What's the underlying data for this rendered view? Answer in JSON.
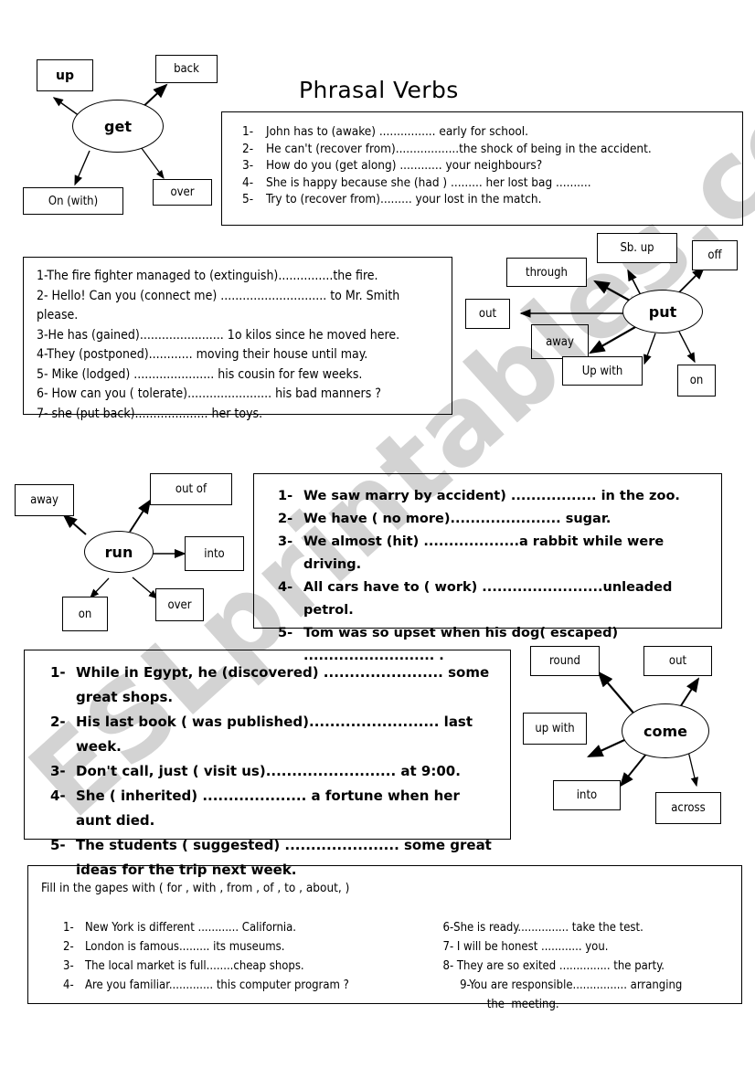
{
  "page": {
    "title": "Phrasal Verbs",
    "watermark": "ESLprintables.com"
  },
  "diagrams": [
    {
      "id": "get",
      "hub": "get",
      "nodes": [
        "up",
        "back",
        "On (with)",
        "over"
      ]
    },
    {
      "id": "put",
      "hub": "put",
      "nodes": [
        "Sb. up",
        "off",
        "through",
        "out",
        "away",
        "Up with",
        "on"
      ]
    },
    {
      "id": "run",
      "hub": "run",
      "nodes": [
        "away",
        "out of",
        "into",
        "on",
        "over"
      ]
    },
    {
      "id": "come",
      "hub": "come",
      "nodes": [
        "round",
        "out",
        "up with",
        "into",
        "across"
      ]
    }
  ],
  "exercise1": {
    "items": [
      {
        "num": "1-",
        "text": "John has to (awake) ................ early for school."
      },
      {
        "num": "2-",
        "text": "He can't (recover from)..................the shock of being in the accident."
      },
      {
        "num": "3-",
        "text": "How do you (get along) ............ your neighbours?"
      },
      {
        "num": "4-",
        "text": "She is happy because she (had )   ......... her lost bag .........."
      },
      {
        "num": "5-",
        "text": "Try to (recover from)......... your lost in the match."
      }
    ]
  },
  "exercise2": {
    "items": [
      {
        "num": "",
        "text": "1-The fire fighter managed to (extinguish)...............the fire."
      },
      {
        "num": "",
        "text": "2- Hello! Can you (connect me) ............................. to Mr. Smith"
      },
      {
        "num": "",
        "text": "please."
      },
      {
        "num": "",
        "text": "3-He has (gained)....................... 1o kilos since he moved here."
      },
      {
        "num": "",
        "text": "4-They (postponed)............ moving their house until may."
      },
      {
        "num": "",
        "text": "5- Mike (lodged) ...................... his cousin for few weeks."
      },
      {
        "num": "",
        "text": "6- How can you ( tolerate)....................... his bad manners  ?"
      },
      {
        "num": "",
        "text": "7- she (put back).................... her toys."
      }
    ]
  },
  "exercise3": {
    "items": [
      {
        "num": "1-",
        "text": "We  saw marry by accident) ................. in the zoo."
      },
      {
        "num": "2-",
        "text": "We have ( no more)...................... sugar."
      },
      {
        "num": "3-",
        "text": "We almost (hit) ...................a rabbit while were driving."
      },
      {
        "num": "4-",
        "text": "All cars have to ( work) ........................unleaded petrol."
      },
      {
        "num": "5-",
        "text": "Tom was so upset when his dog( escaped) .......................... ."
      }
    ]
  },
  "exercise4": {
    "items": [
      {
        "num": "1-",
        "text": "While in Egypt, he (discovered) ....................... some great shops."
      },
      {
        "num": "2-",
        "text": "His last book ( was published)......................... last week."
      },
      {
        "num": "3-",
        "text": "Don't call, just ( visit us)......................... at 9:00."
      },
      {
        "num": "4-",
        "text": "She  ( inherited) .................... a fortune when her aunt died."
      },
      {
        "num": "5-",
        "text": "The students ( suggested) ...................... some great ideas for the trip next week."
      }
    ]
  },
  "exercise5": {
    "heading": "Fill in the gapes with ( for , with ,  from , of , to , about,  )",
    "left_items": [
      {
        "num": "1-",
        "text": "New York is different ............ California."
      },
      {
        "num": "2-",
        "text": "London is famous......... its museums."
      },
      {
        "num": "3-",
        "text": "The local market  is full........cheap shops."
      },
      {
        "num": "4-",
        "text": "Are you  familiar............. this computer program ?"
      }
    ],
    "right_items": [
      {
        "num": "",
        "text": "6-She is ready............... take the test."
      },
      {
        "num": "",
        "text": "7- I will be honest ............ you."
      },
      {
        "num": "",
        "text": "8- They   are so exited ............... the party."
      },
      {
        "num": "",
        "text": "     9-You are responsible................ arranging"
      },
      {
        "num": "",
        "text": "             the  meeting."
      }
    ]
  }
}
